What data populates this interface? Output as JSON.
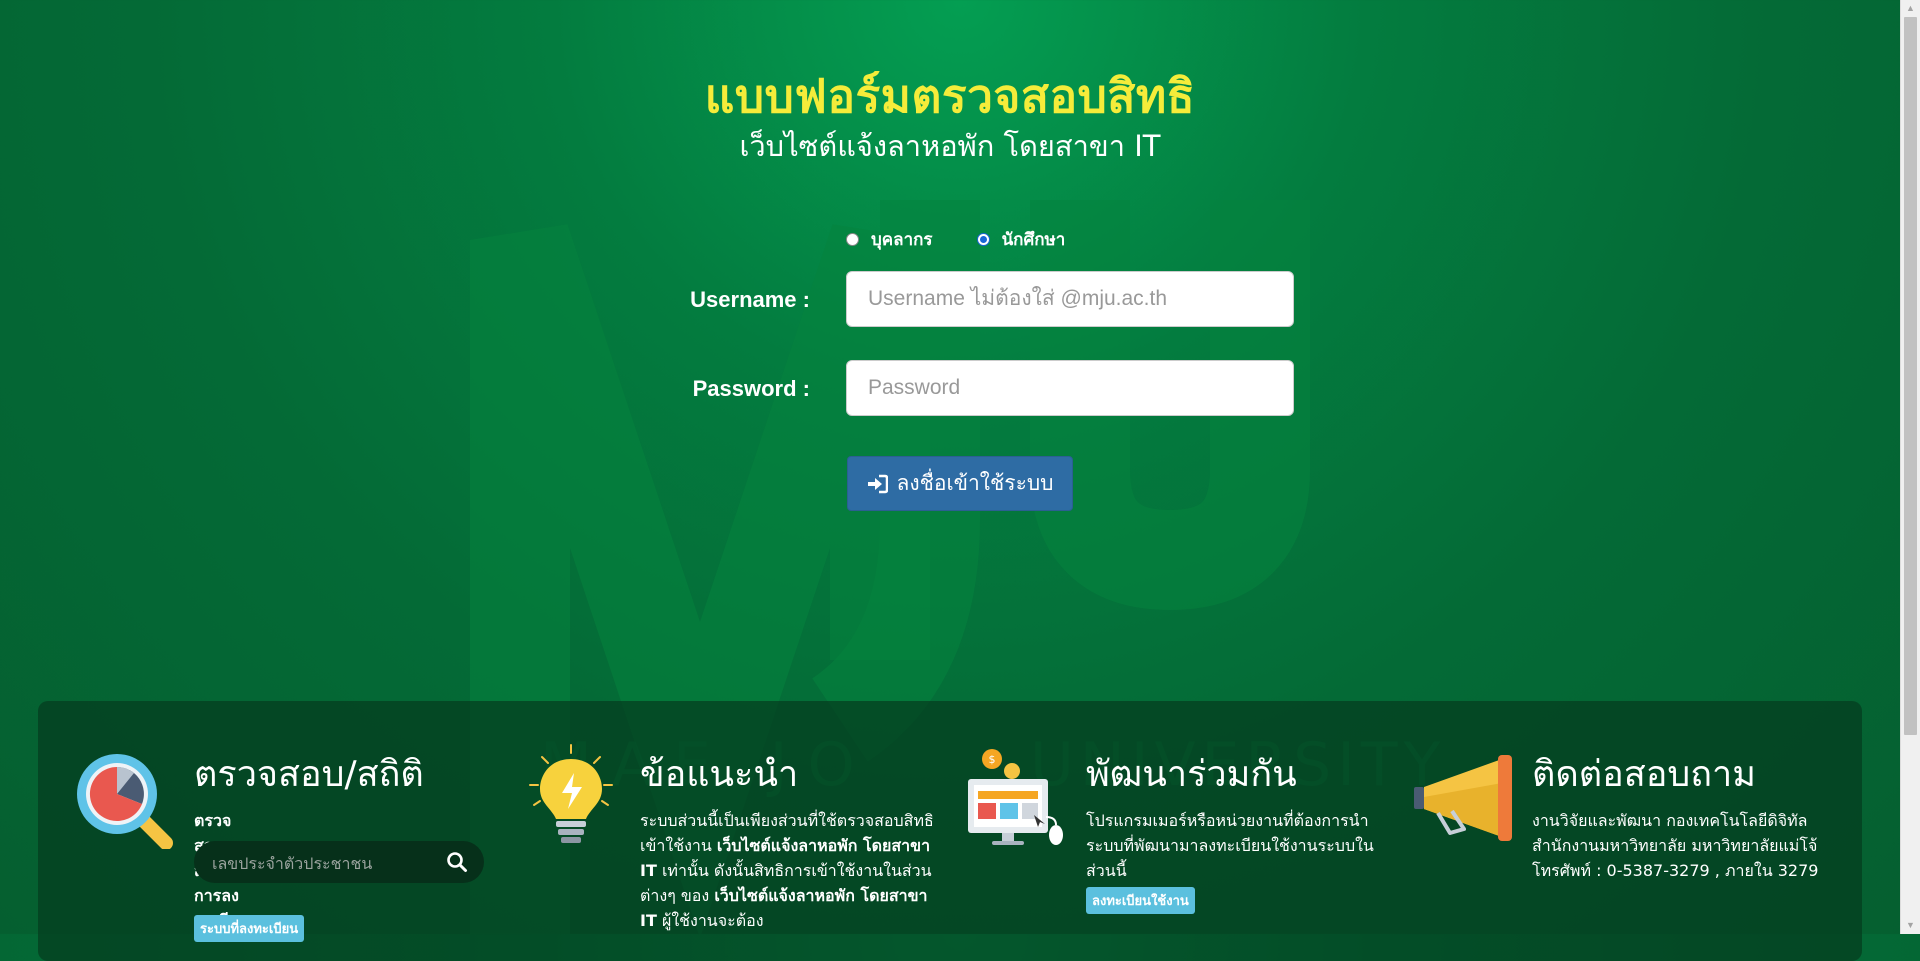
{
  "header": {
    "title": "แบบฟอร์มตรวจสอบสิทธิ",
    "subtitle": "เว็บไซต์แจ้งลาหอพัก โดยสาขา IT"
  },
  "watermark": {
    "logo_text": "MJU",
    "tagline_left": "MAE JO",
    "tagline_right": "UNIVERSITY"
  },
  "login": {
    "user_type": {
      "options": [
        "บุคลากร",
        "นักศึกษา"
      ],
      "selected": "นักศึกษา"
    },
    "username_label": "Username :",
    "username_placeholder": "Username ไม่ต้องใส่ @mju.ac.th",
    "password_label": "Password :",
    "password_placeholder": "Password",
    "submit_label": "ลงชื่อเข้าใช้ระบบ",
    "submit_icon": "sign-in-icon"
  },
  "sections": {
    "check": {
      "icon": "magnifier-chart-icon",
      "title": "ตรวจสอบ/สถิติ",
      "subtitle": "ตรวจสอบสถานะการลงทะเบียน",
      "search_placeholder": "เลขประจำตัวประชาชน",
      "badge": "ระบบที่ลงทะเบียน"
    },
    "advice": {
      "icon": "lightbulb-icon",
      "title": "ข้อแนะนำ",
      "text_1": "ระบบส่วนนี้เป็นเพียงส่วนที่ใช้ตรวจสอบสิทธิเข้าใช้งาน ",
      "text_bold_1": "เว็บไซต์แจ้งลาหอพัก โดยสาขา IT",
      "text_2": " เท่านั้น ดังนั้นสิทธิการเข้าใช้งานในส่วนต่างๆ ของ ",
      "text_bold_2": "เว็บไซต์แจ้งลาหอพัก โดยสาขา IT",
      "text_3": " ผู้ใช้งานจะต้อง"
    },
    "develop": {
      "icon": "computer-icon",
      "title": "พัฒนาร่วมกัน",
      "text": "โปรแกรมเมอร์หรือหน่วยงานที่ต้องการนำระบบที่พัฒนามาลงทะเบียนใช้งานระบบในส่วนนี้",
      "badge": "ลงทะเบียนใช้งาน"
    },
    "contact": {
      "icon": "megaphone-icon",
      "title": "ติดต่อสอบถาม",
      "text": "งานวิจัยและพัฒนา กองเทคโนโลยีดิจิทัล สำนักงานมหาวิทยาลัย มหาวิทยาลัยแม่โจ้ โทรศัพท์ : 0-5387-3279 , ภายใน 3279"
    }
  },
  "colors": {
    "title": "#f5ec3a",
    "button": "#2e6ca4",
    "badge": "#5bc0de",
    "radio_selected": "#1a66d6"
  }
}
